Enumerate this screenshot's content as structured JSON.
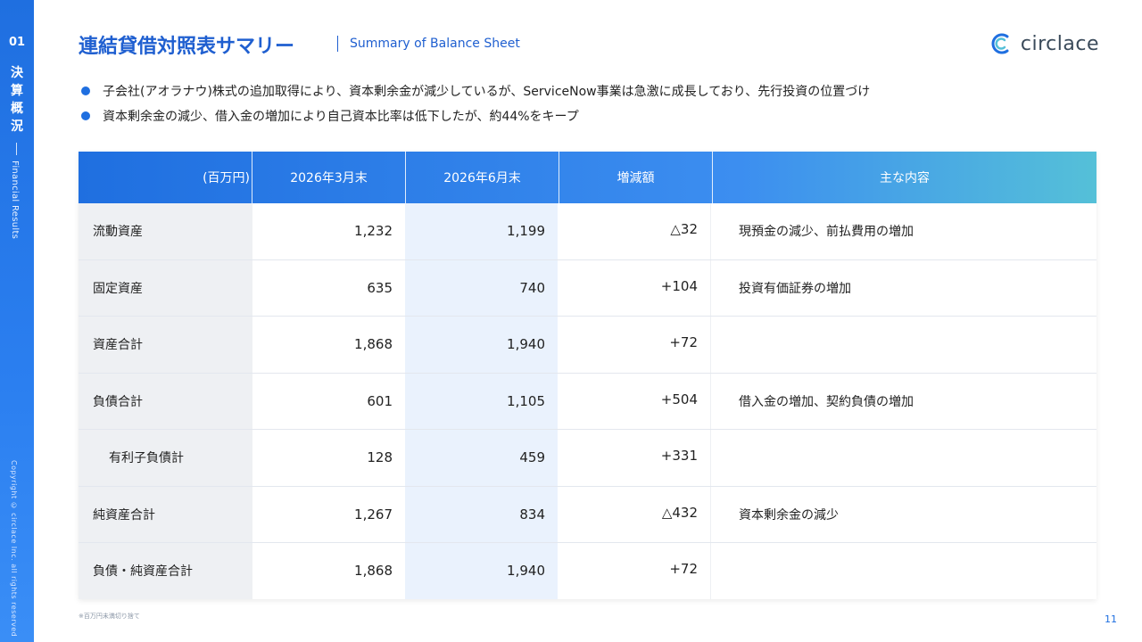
{
  "sidebar": {
    "section_number": "01",
    "section_title": "決\n算\n概\n況",
    "section_subtitle": "Financial Results",
    "copyright": "Copyright © circlace Inc. all rights reserved"
  },
  "header": {
    "title": "連結貸借対照表サマリー",
    "subtitle": "Summary of Balance Sheet",
    "logo_text": "circlace"
  },
  "bullets": [
    "子会社(アオラナウ)株式の追加取得により、資本剰余金が減少しているが、ServiceNow事業は急激に成長しており、先行投資の位置づけ",
    "資本剰余金の減少、借入金の増加により自己資本比率は低下したが、約44%をキープ"
  ],
  "table": {
    "headers": [
      "(百万円)",
      "2026年3月末",
      "2026年6月末",
      "増減額",
      "主な内容"
    ],
    "rows": [
      {
        "label": "流動資産",
        "mar": "1,232",
        "jun": "1,199",
        "change": "△32",
        "note": "現預金の減少、前払費用の増加"
      },
      {
        "label": "固定資産",
        "mar": "635",
        "jun": "740",
        "change": "+104",
        "note": "投資有価証券の増加"
      },
      {
        "label": "資産合計",
        "mar": "1,868",
        "jun": "1,940",
        "change": "+72",
        "note": ""
      },
      {
        "label": "負債合計",
        "mar": "601",
        "jun": "1,105",
        "change": "+504",
        "note": "借入金の増加、契約負債の増加"
      },
      {
        "label": "有利子負債計",
        "mar": "128",
        "jun": "459",
        "change": "+331",
        "note": ""
      },
      {
        "label": "純資産合計",
        "mar": "1,267",
        "jun": "834",
        "change": "△432",
        "note": "資本剰余金の減少"
      },
      {
        "label": "負債・純資産合計",
        "mar": "1,868",
        "jun": "1,940",
        "change": "+72",
        "note": ""
      }
    ]
  },
  "footnote": "※百万円未満切り捨て",
  "page_number": "11",
  "colors": {
    "accent": "#1f6fe0",
    "header_gradient_end": "#55c0d8"
  }
}
